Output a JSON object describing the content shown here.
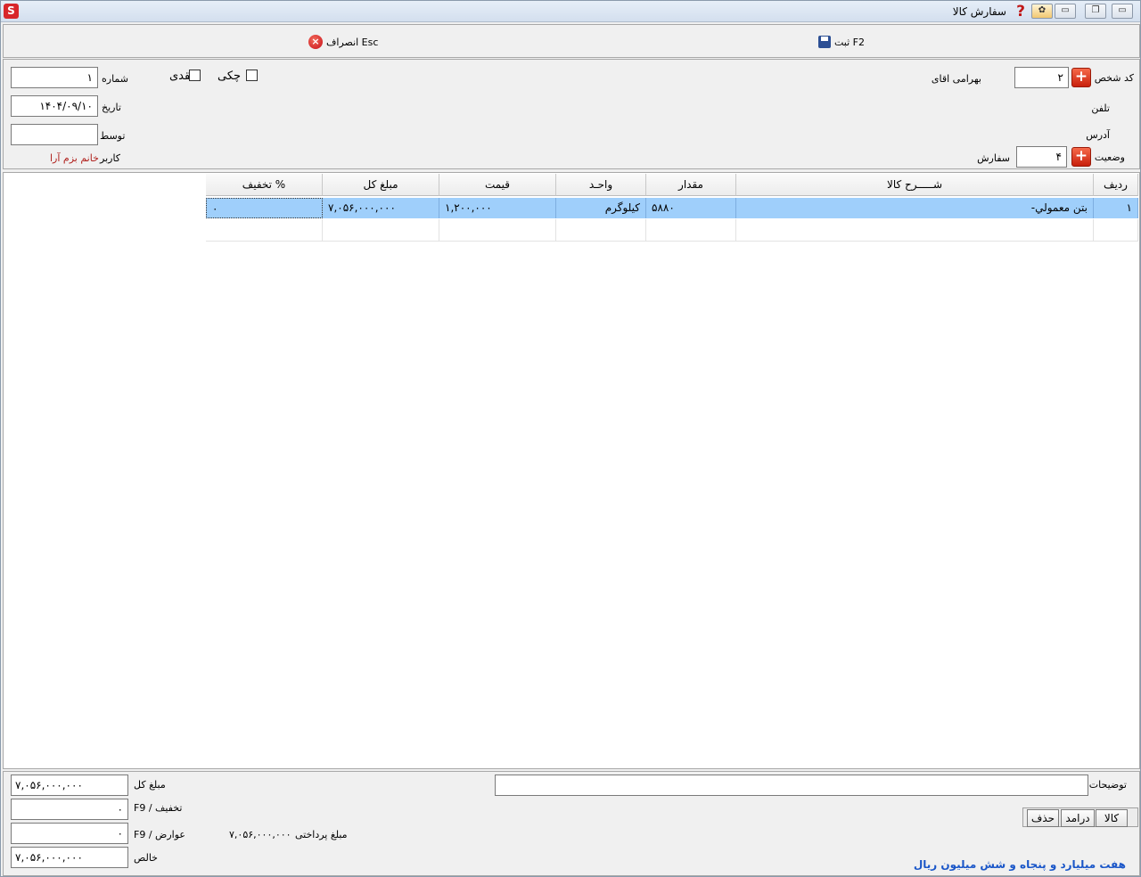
{
  "window": {
    "title": "سفارش کالا",
    "app_logo": "S",
    "help_icon": "help-icon"
  },
  "toolbar": {
    "save_label": "ثبت F2",
    "cancel_label": "انصراف Esc"
  },
  "header": {
    "person_code_label": "کد شخص",
    "person_code_value": "۲",
    "person_name": "بهرامی اقای",
    "phone_label": "تلفن",
    "address_label": "آدرس",
    "status_label": "وضعیت",
    "status_value": "۴",
    "status_text": "سفارش",
    "number_label": "شماره",
    "number_value": "۱",
    "date_label": "تاریخ",
    "date_value": "۱۴۰۴/۰۹/۱۰",
    "by_label": "توسط",
    "by_value": "",
    "user_label": "کاربر",
    "user_value": "خانم بزم آرا",
    "cheque_label": "چکی",
    "cash_label": "نقدی"
  },
  "grid": {
    "columns": [
      "ردیف",
      "شـــــرح کالا",
      "مقدار",
      "واحـد",
      "قیمت",
      "مبلغ کل",
      "% تخفیف"
    ],
    "rows": [
      {
        "row": "۱",
        "desc": "بتن معمولي-",
        "qty": "۵۸۸۰",
        "unit": "کیلوگرم",
        "price": "۱,۲۰۰,۰۰۰",
        "total": "۷,۰۵۶,۰۰۰,۰۰۰",
        "discount": "۰"
      }
    ]
  },
  "footer": {
    "notes_label": "توضیحات",
    "notes_value": "",
    "btn_goods": "کالا",
    "btn_income": "درامد",
    "btn_delete": "حذف",
    "amount_words": "هفت میلیارد و پنجاه و شش میلیون  ریال",
    "total_label": "مبلغ کل",
    "total_value": "۷,۰۵۶,۰۰۰,۰۰۰",
    "discount_label": "تخفیف / F9",
    "discount_value": "۰",
    "fees_label": "عوارض / F9",
    "fees_value": "۰",
    "net_label": "خالص",
    "net_value": "۷,۰۵۶,۰۰۰,۰۰۰",
    "payable_label": "مبلغ پرداختی",
    "payable_value": "۷,۰۵۶,۰۰۰,۰۰۰"
  },
  "colors": {
    "selected_row": "#9fcffb",
    "accent_red": "#d8262a",
    "words_blue": "#1a56c8",
    "user_red": "#b0201c"
  }
}
